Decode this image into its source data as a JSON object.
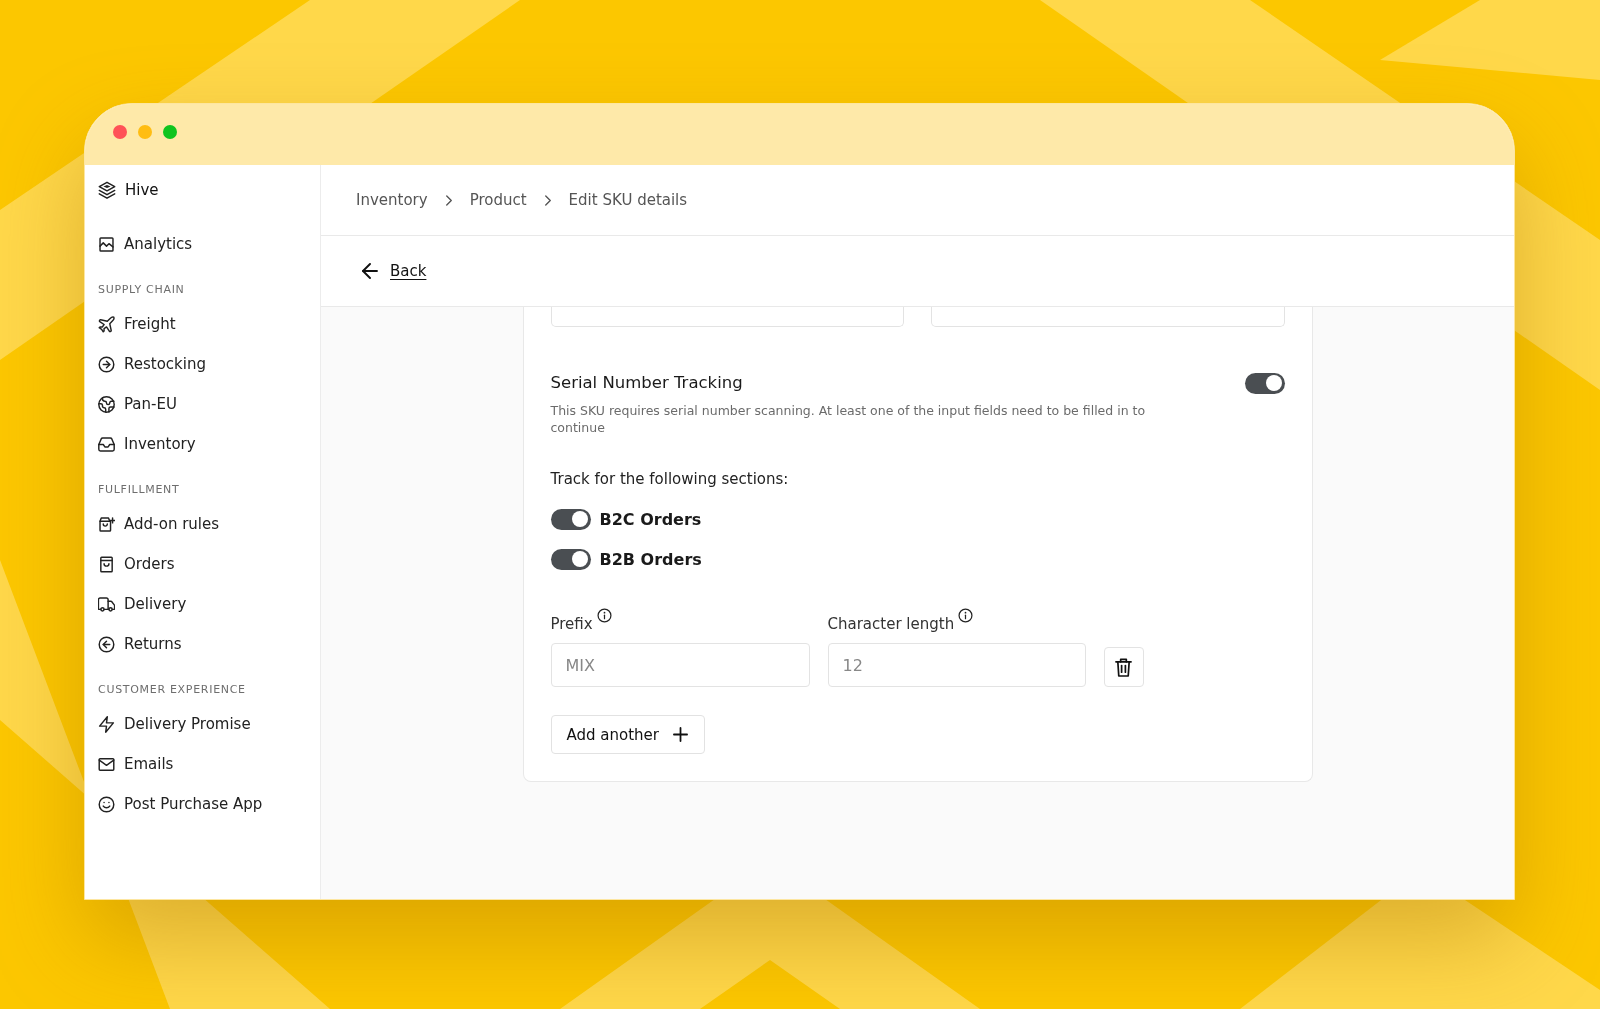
{
  "sidebar": {
    "brand": "Hive",
    "sections": [
      {
        "items": [
          {
            "label": "Analytics"
          }
        ]
      },
      {
        "heading": "SUPPLY CHAIN",
        "items": [
          {
            "label": "Freight"
          },
          {
            "label": "Restocking"
          },
          {
            "label": "Pan-EU"
          },
          {
            "label": "Inventory"
          }
        ]
      },
      {
        "heading": "FULFILLMENT",
        "items": [
          {
            "label": "Add-on rules"
          },
          {
            "label": "Orders"
          },
          {
            "label": "Delivery"
          },
          {
            "label": "Returns"
          }
        ]
      },
      {
        "heading": "CUSTOMER EXPERIENCE",
        "items": [
          {
            "label": "Delivery Promise"
          },
          {
            "label": "Emails"
          },
          {
            "label": "Post Purchase App"
          }
        ]
      }
    ]
  },
  "breadcrumb": [
    {
      "label": "Inventory"
    },
    {
      "label": "Product"
    },
    {
      "label": "Edit SKU details"
    }
  ],
  "back_link": {
    "label": "Back"
  },
  "form": {
    "serial_tracking": {
      "title": "Serial Number Tracking",
      "on": true,
      "description": "This SKU requires serial number scanning. At least one of the input fields need to be filled in to continue"
    },
    "sections_heading": "Track for the following sections:",
    "sections": [
      {
        "label": "B2C Orders",
        "on": true
      },
      {
        "label": "B2B Orders",
        "on": true
      }
    ],
    "rules": [
      {
        "fields": [
          {
            "label": "Prefix",
            "placeholder": "MIX"
          },
          {
            "label": "Character length",
            "placeholder": "12"
          }
        ]
      }
    ],
    "add_button": {
      "label": "Add another"
    }
  }
}
